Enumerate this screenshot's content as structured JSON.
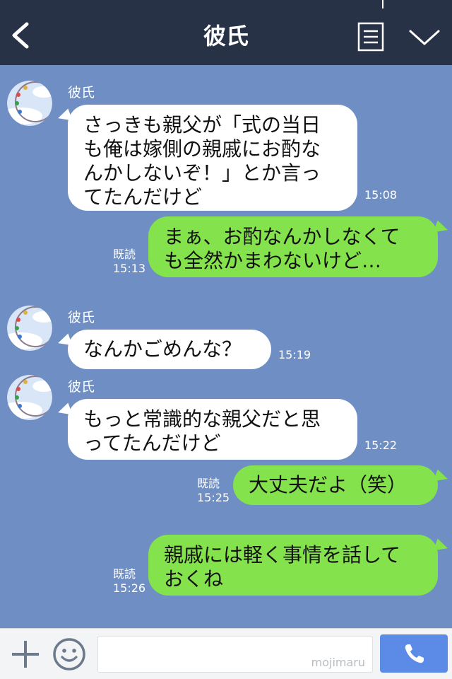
{
  "header": {
    "title": "彼氏",
    "back_icon": "chevron-left-icon",
    "memo_icon": "memo-list-icon",
    "menu_icon": "chevron-down-icon"
  },
  "messages": [
    {
      "side": "in",
      "sender": "彼氏",
      "lines": [
        "さっきも親父が「式の当日",
        "も俺は嫁側の親戚にお酌な",
        "んかしないぞ！」とか言っ",
        "てたんだけど"
      ],
      "time": "15:08"
    },
    {
      "side": "out",
      "read": "既読",
      "time": "15:13",
      "lines": [
        "まぁ、お酌なんかしなくて",
        "も全然かまわないけど…"
      ]
    },
    {
      "side": "in",
      "sender": "彼氏",
      "lines": [
        "なんかごめんな？"
      ],
      "time": "15:19"
    },
    {
      "side": "in",
      "sender": "彼氏",
      "lines": [
        "もっと常識的な親父だと思",
        "ってたんだけど"
      ],
      "time": "15:22"
    },
    {
      "side": "out",
      "read": "既読",
      "time": "15:25",
      "lines": [
        "大丈夫だよ（笑）"
      ]
    },
    {
      "side": "out",
      "read": "既読",
      "time": "15:26",
      "lines": [
        "親戚には軽く事情を話して",
        "おくね"
      ]
    }
  ],
  "bottom_bar": {
    "plus_icon": "plus-icon",
    "emoji_icon": "smiley-icon",
    "input_value": "",
    "watermark": "mojimaru",
    "call_icon": "phone-icon"
  },
  "colors": {
    "header_bg": "#273246",
    "chat_bg": "#6f8fc4",
    "incoming_bubble": "#ffffff",
    "outgoing_bubble": "#84e24c",
    "call_button": "#5b8be6"
  }
}
